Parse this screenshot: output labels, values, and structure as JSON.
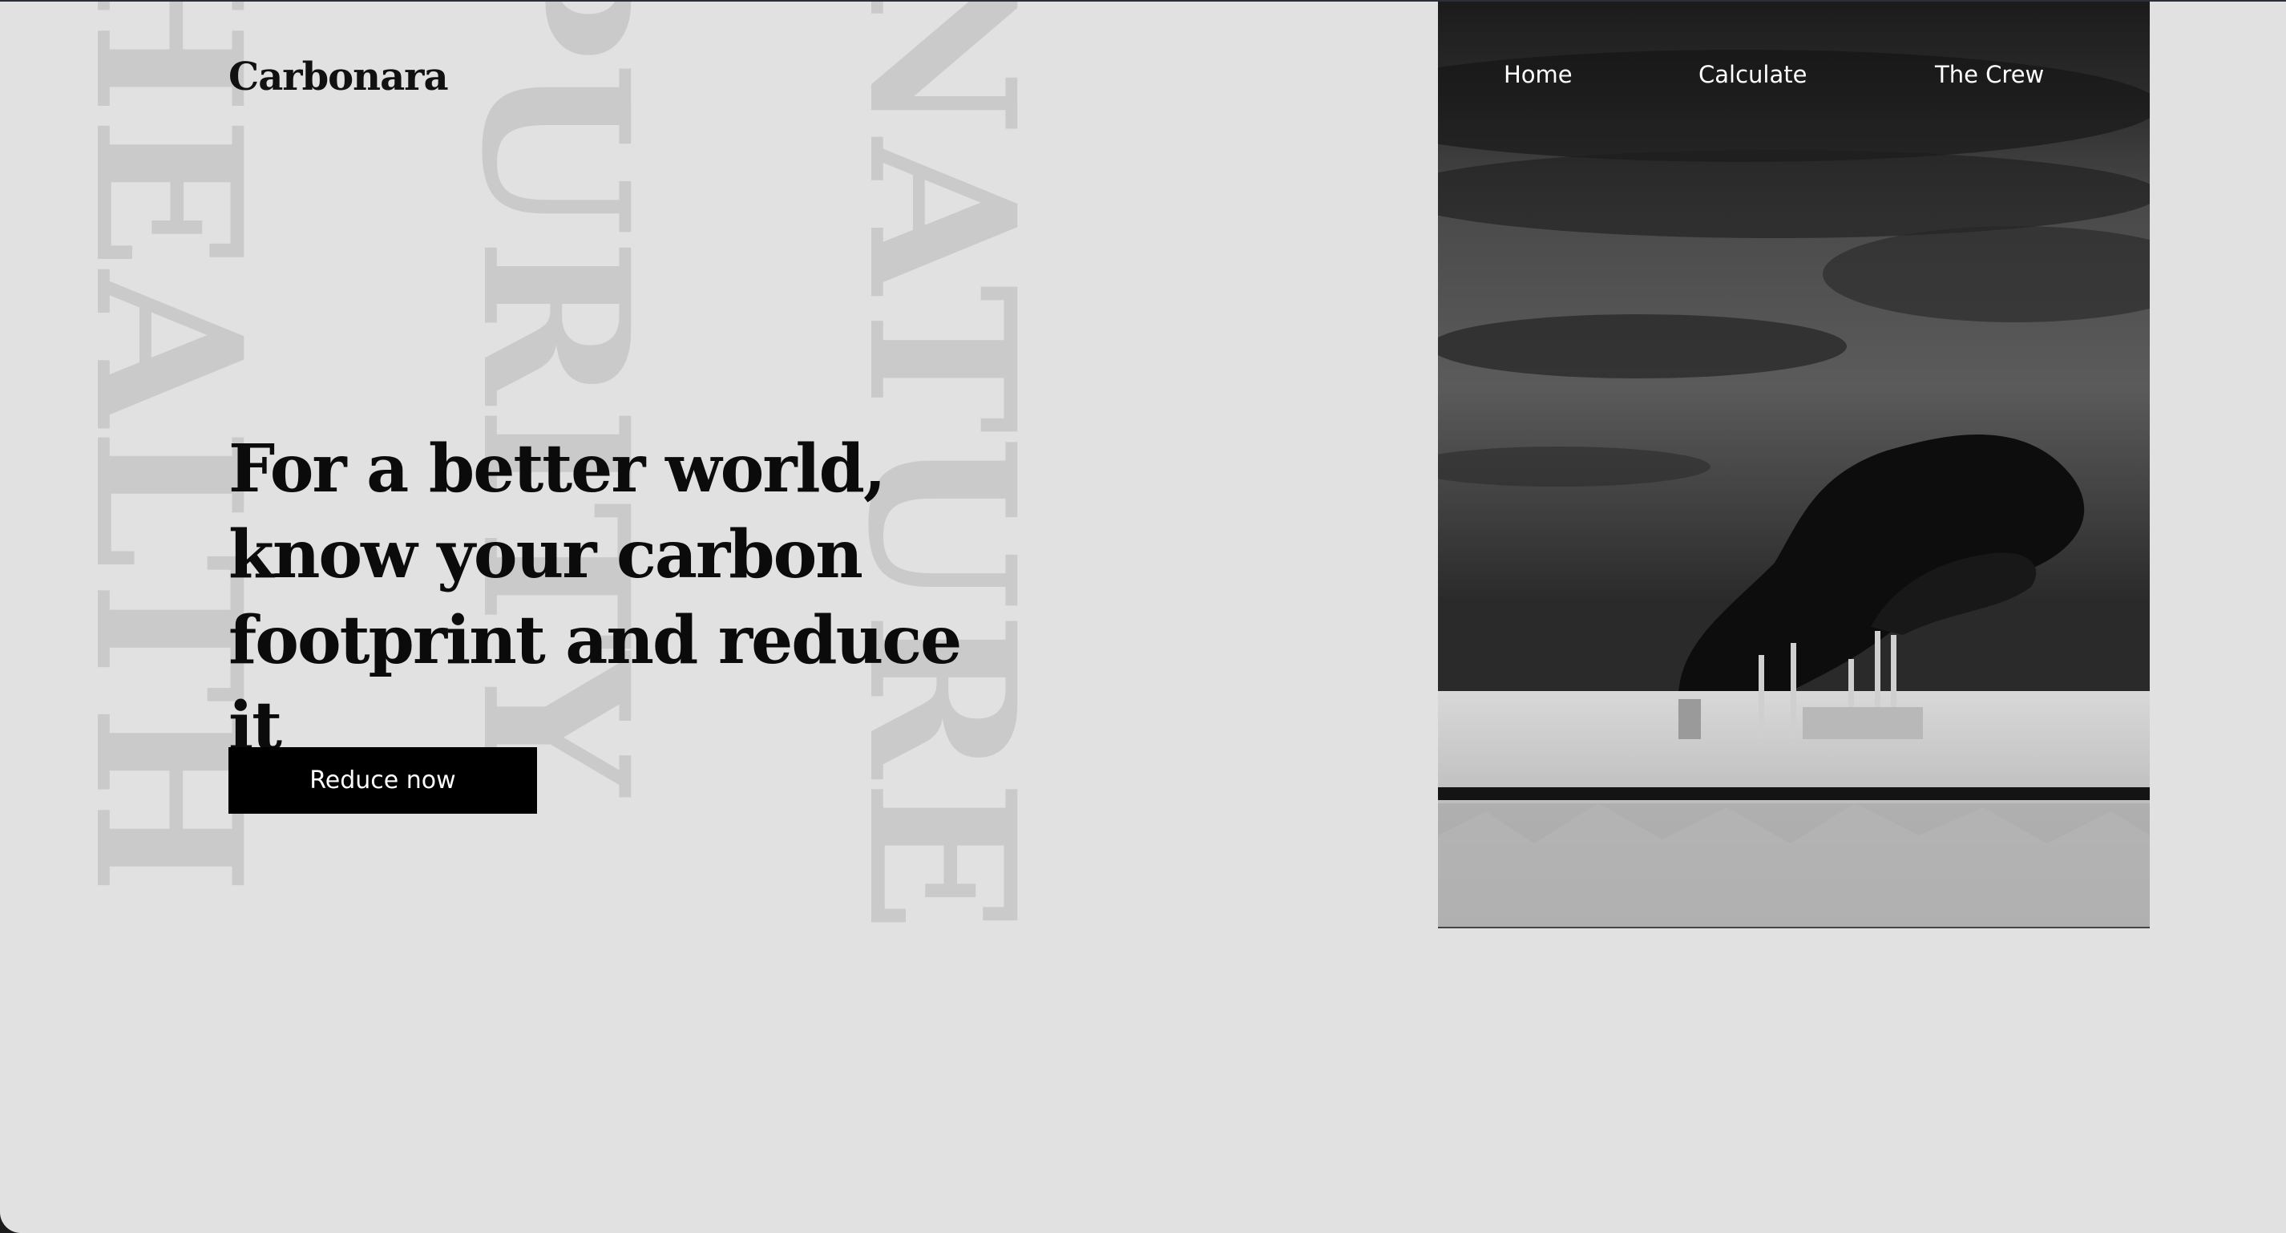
{
  "brand": {
    "name": "Carbonara"
  },
  "background_words": [
    "HEALTH",
    "PURITY",
    "NATURE"
  ],
  "nav": {
    "items": [
      "Home",
      "Calculate",
      "The Crew"
    ]
  },
  "hero": {
    "headline": "For a better world, know your carbon footprint and reduce it",
    "cta_label": "Reduce now"
  },
  "colors": {
    "page_bg": "#e1e1e1",
    "watermark_text": "#cacaca",
    "primary_text": "#0b0b0b",
    "button_bg": "#000000",
    "button_text": "#ffffff",
    "nav_text": "#ffffff"
  }
}
